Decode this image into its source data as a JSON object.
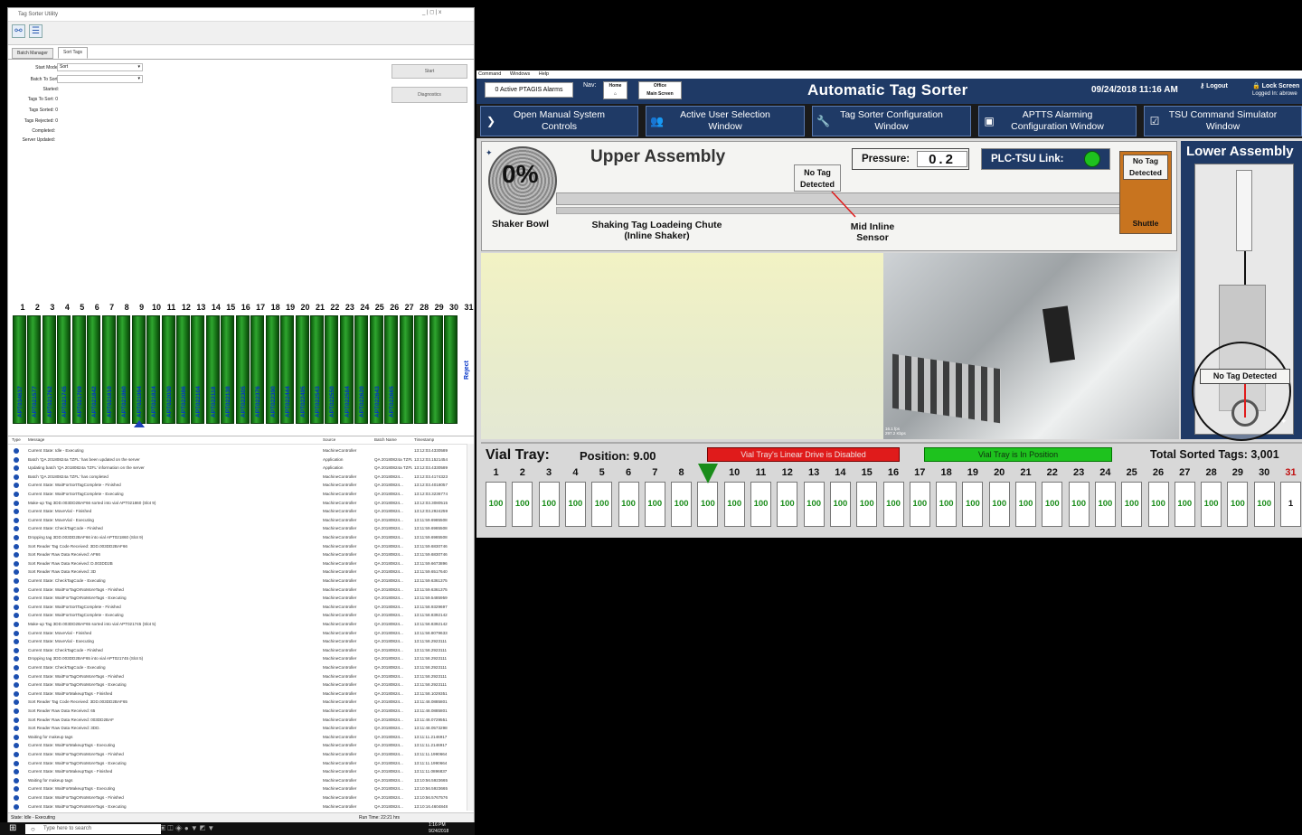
{
  "left_window": {
    "title": "Tag Sorter Utility",
    "window_controls": "_ | ◻ | x",
    "tabs": [
      "Batch Manager",
      "Sort Tags"
    ],
    "form": {
      "start_mode_label": "Start Mode:",
      "start_mode_value": "Sort",
      "batch_label": "Batch To Sort:",
      "batch_value": "",
      "started_label": "Started:",
      "started_value": "",
      "tags_to_sort_label": "Tags To Sort:",
      "tags_to_sort_value": "0",
      "tags_sorted_label": "Tags Sorted:",
      "tags_sorted_value": "0",
      "tags_rejected_label": "Tags Rejected:",
      "tags_rejected_value": "0",
      "completed_label": "Completed:",
      "completed_value": "",
      "server_updated_label": "Server Updated:",
      "server_updated_value": ""
    },
    "start_button": "Start",
    "diagnostics_button": "Diagnostics",
    "slot_numbers": [
      "1",
      "2",
      "3",
      "4",
      "5",
      "6",
      "7",
      "8",
      "9",
      "10",
      "11",
      "12",
      "13",
      "14",
      "15",
      "16",
      "17",
      "18",
      "19",
      "20",
      "21",
      "22",
      "23",
      "24",
      "25",
      "26",
      "27",
      "28",
      "29",
      "30",
      "31"
    ],
    "vials": [
      "APT034637",
      "APT021577",
      "APT021762",
      "APT021745",
      "APT021709",
      "APT021842",
      "APT021810",
      "APT021860",
      "APT021994",
      "APT021824",
      "APT022030",
      "APT022086",
      "APT022104",
      "APT022118",
      "APT022138",
      "APT022305",
      "APT022376",
      "APT022390",
      "APT022444",
      "APT022495",
      "APT022543",
      "APT022550",
      "APT022584",
      "APT022620",
      "APT022643",
      "APT022665"
    ],
    "reject_label": "Reject",
    "log_headers": {
      "type": "Type",
      "message": "Message",
      "source": "Source",
      "batch": "Batch Name",
      "time": "Timestamp"
    },
    "log": [
      {
        "m": "Current State: Idle - Executing",
        "s": "MachineController",
        "b": "",
        "t": "13:12:03.4330589"
      },
      {
        "m": "Batch 'QA 20180824a TZFL' has been updated on the server",
        "s": "Application",
        "b": "QA 20180824a TZFL",
        "t": "13:12:03.1521454"
      },
      {
        "m": "Updating batch 'QA 20180824a TZFL' information on the server",
        "s": "Application",
        "b": "QA 20180824a TZFL",
        "t": "13:12:03.4330589"
      },
      {
        "m": "Batch 'QA 20180824a TZFL' has completed",
        "s": "MachineController",
        "b": "QA 20180824...",
        "t": "13:12:03.4174323"
      },
      {
        "m": "Current State: WaitForSortTagComplete - Finished",
        "s": "MachineController",
        "b": "QA 20180824...",
        "t": "13:12:03.4018057"
      },
      {
        "m": "Current State: WaitForSortTagComplete - Executing",
        "s": "MachineController",
        "b": "QA 20180824...",
        "t": "13:12:03.3236774"
      },
      {
        "m": "Make-up Tag 3DD.003DD2BAF66 sorted into vial APT021860 (Slot 9)",
        "s": "MachineController",
        "b": "QA 20180824...",
        "t": "13:12:03.3080515"
      },
      {
        "m": "Current State: MoveVial - Finished",
        "s": "MachineController",
        "b": "QA 20180824...",
        "t": "13:12:03.2924259"
      },
      {
        "m": "Current State: MoveVial - Executing",
        "s": "MachineController",
        "b": "QA 20180824...",
        "t": "13:11:59.6985508"
      },
      {
        "m": "Current State: CheckTagCode - Finished",
        "s": "MachineController",
        "b": "QA 20180824...",
        "t": "13:11:59.6985508"
      },
      {
        "m": "Dropping tag 3DD.003DD2BAF66 into vial APT021860 (Slot 9)",
        "s": "MachineController",
        "b": "QA 20180824...",
        "t": "13:11:59.6985508"
      },
      {
        "m": "Sort Reader Tag Code Received: 3DD.003DD2BAF66",
        "s": "MachineController",
        "b": "QA 20180824...",
        "t": "13:11:59.6830746"
      },
      {
        "m": "Sort Reader Raw Data Received: AF66",
        "s": "MachineController",
        "b": "QA 20180824...",
        "t": "13:11:59.6830746"
      },
      {
        "m": "Sort Reader Raw Data Received: D.003DD2B",
        "s": "MachineController",
        "b": "QA 20180824...",
        "t": "13:11:59.6673896"
      },
      {
        "m": "Sort Reader Raw Data Received: 3D",
        "s": "MachineController",
        "b": "QA 20180824...",
        "t": "13:11:59.6517640"
      },
      {
        "m": "Current State: CheckTagCode - Executing",
        "s": "MachineController",
        "b": "QA 20180824...",
        "t": "13:11:59.6361375"
      },
      {
        "m": "Current State: WaitForTagOrNoMoreTags - Finished",
        "s": "MachineController",
        "b": "QA 20180824...",
        "t": "13:11:59.6361375"
      },
      {
        "m": "Current State: WaitForTagOrNoMoreTags - Executing",
        "s": "MachineController",
        "b": "QA 20180824...",
        "t": "13:11:59.5485959"
      },
      {
        "m": "Current State: WaitForSortTagComplete - Finished",
        "s": "MachineController",
        "b": "QA 20180824...",
        "t": "13:11:58.9329697"
      },
      {
        "m": "Current State: WaitForSortTagComplete - Executing",
        "s": "MachineController",
        "b": "QA 20180824...",
        "t": "13:11:58.8392142"
      },
      {
        "m": "Make-up Tag 3DD.003DD2BAF65 sorted into vial APT021745 (Slot 5)",
        "s": "MachineController",
        "b": "QA 20180824...",
        "t": "13:11:58.8392142"
      },
      {
        "m": "Current State: MoveVial - Finished",
        "s": "MachineController",
        "b": "QA 20180824...",
        "t": "13:11:58.8079633"
      },
      {
        "m": "Current State: MoveVial - Executing",
        "s": "MachineController",
        "b": "QA 20180824...",
        "t": "13:11:58.2923111"
      },
      {
        "m": "Current State: CheckTagCode - Finished",
        "s": "MachineController",
        "b": "QA 20180824...",
        "t": "13:11:58.2923111"
      },
      {
        "m": "Dropping tag 3DD.003DD2BAF65 into vial APT021745 (Slot 5)",
        "s": "MachineController",
        "b": "QA 20180824...",
        "t": "13:11:58.2923111"
      },
      {
        "m": "Current State: CheckTagCode - Executing",
        "s": "MachineController",
        "b": "QA 20180824...",
        "t": "13:11:58.2923111"
      },
      {
        "m": "Current State: WaitForTagOrNoMoreTags - Finished",
        "s": "MachineController",
        "b": "QA 20180824...",
        "t": "13:11:58.2923111"
      },
      {
        "m": "Current State: WaitForTagOrNoMoreTags - Executing",
        "s": "MachineController",
        "b": "QA 20180824...",
        "t": "13:11:58.2923111"
      },
      {
        "m": "Current State: WaitForMakeupTags - Finished",
        "s": "MachineController",
        "b": "QA 20180824...",
        "t": "13:11:58.1029351"
      },
      {
        "m": "Sort Reader Tag Code Received: 3DD.003DD2BAF65",
        "s": "MachineController",
        "b": "QA 20180824...",
        "t": "13:11:48.0885801"
      },
      {
        "m": "Sort Reader Raw Data Received: 65",
        "s": "MachineController",
        "b": "QA 20180824...",
        "t": "13:11:48.0885801"
      },
      {
        "m": "Sort Reader Raw Data Received: 003DD2BAF",
        "s": "MachineController",
        "b": "QA 20180824...",
        "t": "13:11:48.0729551"
      },
      {
        "m": "Sort Reader Raw Data Received: 3DD.",
        "s": "MachineController",
        "b": "QA 20180824...",
        "t": "13:11:48.0573298"
      },
      {
        "m": "Waiting for makeup tags",
        "s": "MachineController",
        "b": "QA 20180824...",
        "t": "13:11:11.2146917"
      },
      {
        "m": "Current State: WaitForMakeupTags - Executing",
        "s": "MachineController",
        "b": "QA 20180824...",
        "t": "13:11:11.2146917"
      },
      {
        "m": "Current State: WaitForTagOrNoMoreTags - Finished",
        "s": "MachineController",
        "b": "QA 20180824...",
        "t": "13:11:11.1990664"
      },
      {
        "m": "Current State: WaitForTagOrNoMoreTags - Executing",
        "s": "MachineController",
        "b": "QA 20180824...",
        "t": "13:11:11.1990664"
      },
      {
        "m": "Current State: WaitForMakeupTags - Finished",
        "s": "MachineController",
        "b": "QA 20180824...",
        "t": "13:11:11.0896837"
      },
      {
        "m": "Waiting for makeup tags",
        "s": "MachineController",
        "b": "QA 20180824...",
        "t": "13:10:56.5923665"
      },
      {
        "m": "Current State: WaitForMakeupTags - Executing",
        "s": "MachineController",
        "b": "QA 20180824...",
        "t": "13:10:56.5923665"
      },
      {
        "m": "Current State: WaitForTagOrNoMoreTags - Finished",
        "s": "MachineController",
        "b": "QA 20180824...",
        "t": "13:10:56.5767576"
      },
      {
        "m": "Current State: WaitForTagOrNoMoreTags - Executing",
        "s": "MachineController",
        "b": "QA 20180824...",
        "t": "13:10:16.4604848"
      }
    ],
    "status_left": "State: Idle - Executing",
    "status_right": "Run Time: 22:21 hrs"
  },
  "taskbar": {
    "search_placeholder": "Type here to search",
    "time": "1:16 PM",
    "date": "9/24/2018"
  },
  "hmi": {
    "menu": [
      "Command",
      "Windows",
      "Help"
    ],
    "alarms": "0 Active PTAGIS Alarms",
    "nav_label": "Nav:",
    "nav_home": "Home",
    "nav_office": "Office",
    "nav_main": "Main Screen",
    "title": "Automatic Tag Sorter",
    "datetime": "09/24/2018 11:16 AM",
    "logout": "Logout",
    "lock": "Lock Screen",
    "logged_in": "Logged In: abrowe",
    "buttons": [
      {
        "l1": "Open Manual System",
        "l2": "Controls"
      },
      {
        "l1": "Active User Selection",
        "l2": "Window"
      },
      {
        "l1": "Tag Sorter Configuration",
        "l2": "Window"
      },
      {
        "l1": "APTTS Alarming",
        "l2": "Configuration Window"
      },
      {
        "l1": "TSU Command Simulator",
        "l2": "Window"
      }
    ],
    "upper_title": "Upper Assembly",
    "shaker_pct": "0%",
    "shaker_label": "Shaker Bowl",
    "chute_label1": "Shaking Tag Loadeing Chute",
    "chute_label2": "(Inline Shaker)",
    "no_tag_1": "No Tag",
    "no_tag_2": "Detected",
    "mid_sensor1": "Mid Inline",
    "mid_sensor2": "Sensor",
    "pressure_label": "Pressure:",
    "pressure_value": "0.2",
    "plc_label": "PLC-TSU Link:",
    "shuttle_label": "Shuttle",
    "lower_title": "Lower Assembly",
    "lower_no_tag": "No Tag Detected",
    "cam_caption1": "16.1 fps",
    "cam_caption2": "297.2 Kbps",
    "vial_title": "Vial Tray:",
    "position_label": "Position:",
    "position_value": "9.00",
    "drive_status": "Vial Tray's Linear Drive is Disabled",
    "tray_status": "Vial Tray is In Position",
    "total_label": "Total Sorted Tags:",
    "total_value": "3,001",
    "tray_slots": [
      "1",
      "2",
      "3",
      "4",
      "5",
      "6",
      "7",
      "8",
      "9",
      "10",
      "11",
      "12",
      "13",
      "14",
      "15",
      "16",
      "17",
      "18",
      "19",
      "20",
      "21",
      "22",
      "23",
      "24",
      "25",
      "26",
      "27",
      "28",
      "29",
      "30",
      "31"
    ],
    "tray_counts": [
      "100",
      "100",
      "100",
      "100",
      "100",
      "100",
      "100",
      "100",
      "100",
      "100",
      "100",
      "100",
      "100",
      "100",
      "100",
      "100",
      "100",
      "100",
      "100",
      "100",
      "100",
      "100",
      "100",
      "100",
      "100",
      "100",
      "100",
      "100",
      "100",
      "100",
      "1"
    ],
    "colors": {
      "header_blue": "#1f3a66",
      "red": "#e01b1b",
      "green": "#1ec21e",
      "vial_green": "#1a8c1a",
      "shuttle": "#c8741f"
    }
  }
}
